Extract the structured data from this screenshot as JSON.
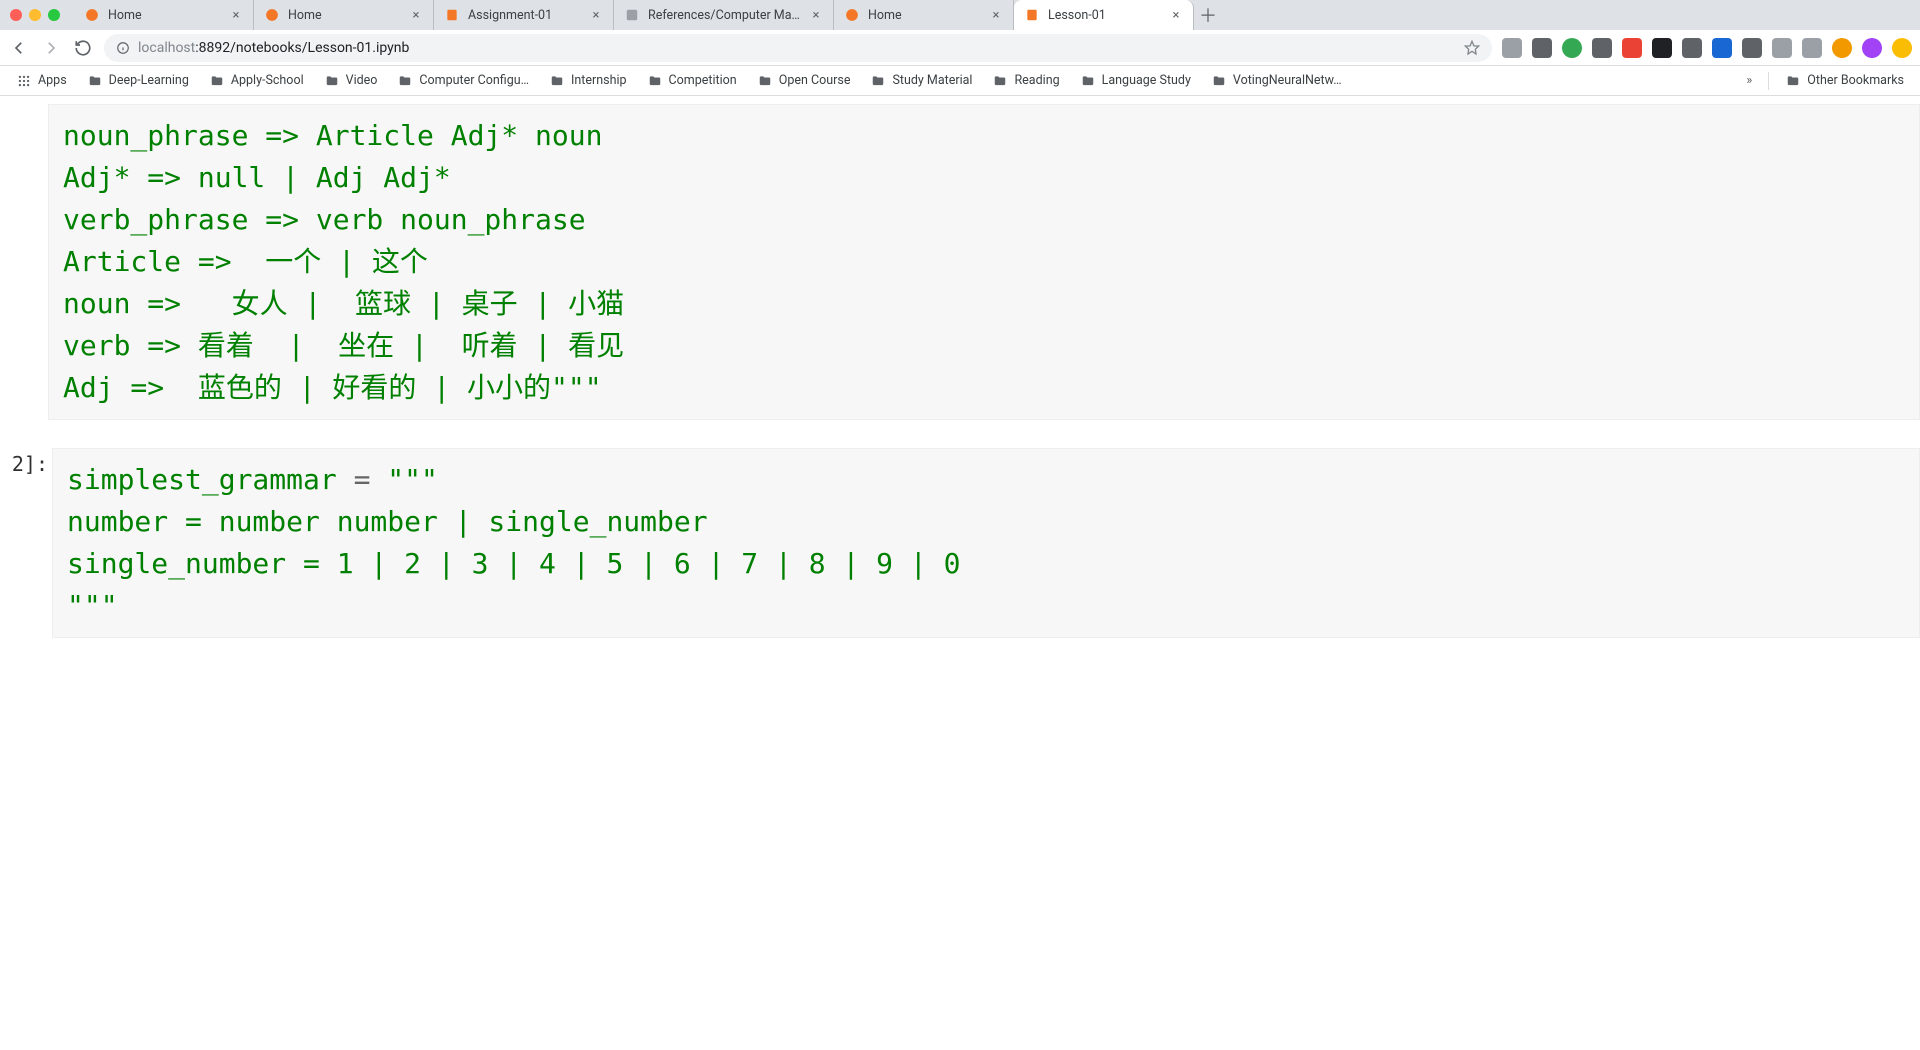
{
  "window": {
    "tabs": [
      {
        "title": "Home",
        "favicon": "jupyter",
        "active": false
      },
      {
        "title": "Home",
        "favicon": "jupyter",
        "active": false
      },
      {
        "title": "Assignment-01",
        "favicon": "notebook",
        "active": false
      },
      {
        "title": "References/Computer Machine",
        "favicon": "generic",
        "active": false
      },
      {
        "title": "Home",
        "favicon": "jupyter",
        "active": false
      },
      {
        "title": "Lesson-01",
        "favicon": "notebook",
        "active": true
      }
    ]
  },
  "addressbar": {
    "host_dim": "localhost",
    "rest": ":8892/notebooks/Lesson-01.ipynb"
  },
  "bookmarks": {
    "apps_label": "Apps",
    "items": [
      "Deep-Learning",
      "Apply-School",
      "Video",
      "Computer Configu…",
      "Internship",
      "Competition",
      "Open Course",
      "Study Material",
      "Reading",
      "Language Study",
      "VotingNeuralNetw…"
    ],
    "other_label": "Other Bookmarks"
  },
  "cells": {
    "cell1": {
      "lines": [
        "noun_phrase => Article Adj* noun",
        "Adj* => null | Adj Adj*",
        "verb_phrase => verb noun_phrase",
        "Article =>  一个 | 这个",
        "noun =>   女人 |  篮球 | 桌子 | 小猫",
        "verb => 看着  |  坐在 |  听着 | 看见",
        "Adj =>  蓝色的 | 好看的 | 小小的\"\"\""
      ]
    },
    "cell2": {
      "prompt": "2]:",
      "line1_name": "simplest_grammar",
      "line1_eq": " = ",
      "line1_rest": "\"\"\"",
      "line2": "number = number number | single_number",
      "line3": "single_number = 1 | 2 | 3 | 4 | 5 | 6 | 7 | 8 | 9 | 0",
      "line4": "\"\"\""
    }
  }
}
